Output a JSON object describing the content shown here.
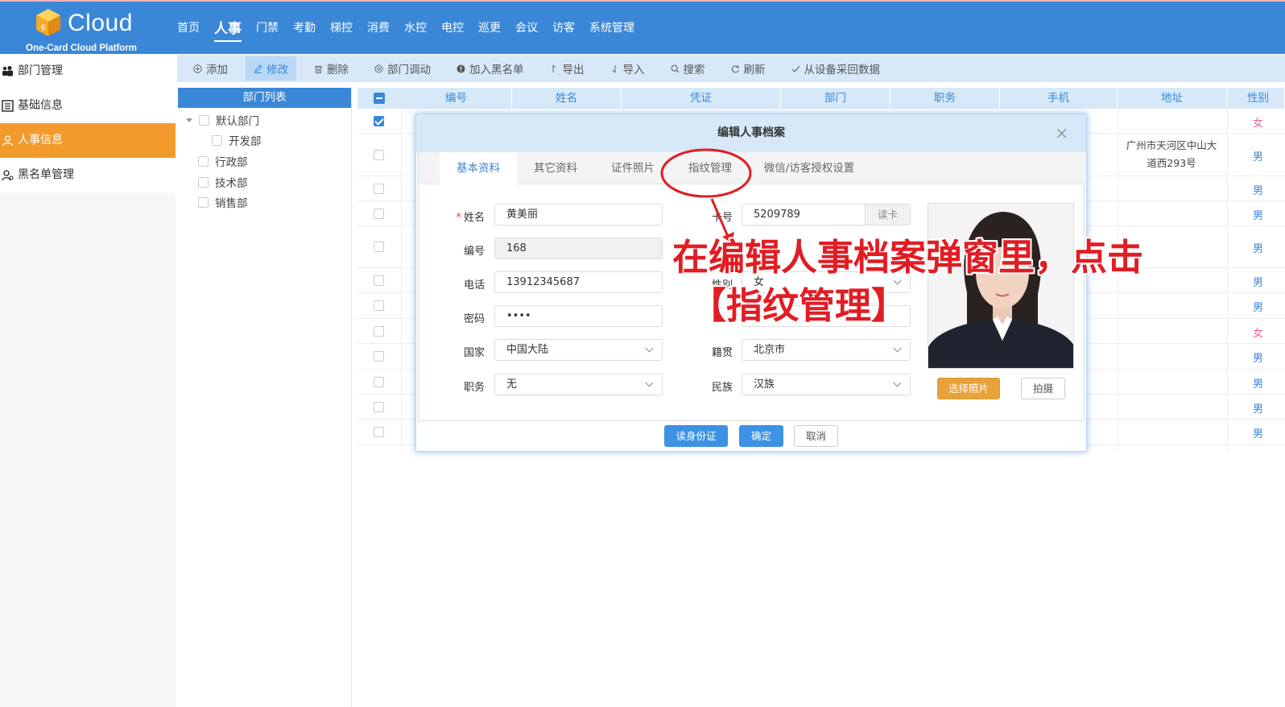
{
  "header": {
    "brand": "Cloud",
    "subtitle": "One-Card Cloud Platform",
    "cube_mark": "卡",
    "nav": [
      "首页",
      "人事",
      "门禁",
      "考勤",
      "梯控",
      "消费",
      "水控",
      "电控",
      "巡更",
      "会议",
      "访客",
      "系统管理"
    ],
    "active_nav": "人事"
  },
  "sidebar": {
    "items": [
      {
        "label": "部门管理",
        "icon": "group-icon"
      },
      {
        "label": "基础信息",
        "icon": "list-icon"
      },
      {
        "label": "人事信息",
        "icon": "user-icon"
      },
      {
        "label": "黑名单管理",
        "icon": "blacklist-user-icon"
      }
    ],
    "active": "人事信息"
  },
  "toolbar": {
    "buttons": [
      {
        "label": "添加",
        "icon": "plus-circle-icon"
      },
      {
        "label": "修改",
        "icon": "edit-icon"
      },
      {
        "label": "删除",
        "icon": "trash-icon"
      },
      {
        "label": "部门调动",
        "icon": "transfer-icon"
      },
      {
        "label": "加入黑名单",
        "icon": "blacklist-icon"
      },
      {
        "label": "导出",
        "icon": "export-icon"
      },
      {
        "label": "导入",
        "icon": "import-icon"
      },
      {
        "label": "搜索",
        "icon": "search-icon"
      },
      {
        "label": "刷新",
        "icon": "refresh-icon"
      },
      {
        "label": "从设备采回数据",
        "icon": "check-icon"
      }
    ],
    "active": "修改"
  },
  "dept_panel": {
    "title": "部门列表",
    "tree": [
      {
        "label": "默认部门",
        "level": 0,
        "expandable": true
      },
      {
        "label": "开发部",
        "level": 1
      },
      {
        "label": "行政部",
        "level": 0
      },
      {
        "label": "技术部",
        "level": 0
      },
      {
        "label": "销售部",
        "level": 0
      }
    ]
  },
  "grid": {
    "columns": [
      "编号",
      "姓名",
      "凭证",
      "部门",
      "职务",
      "手机",
      "地址",
      "性别"
    ],
    "rows": [
      {
        "checked": true,
        "gender": "女",
        "address": ""
      },
      {
        "checked": false,
        "gender": "男",
        "address_line1": "广州市天河区中山大",
        "address_line2": "道西293号"
      },
      {
        "checked": false,
        "gender": "男"
      },
      {
        "checked": false,
        "gender": "男"
      },
      {
        "checked": false,
        "gender": "男"
      },
      {
        "checked": false,
        "gender": "男"
      },
      {
        "checked": false,
        "gender": "男"
      },
      {
        "checked": false,
        "gender": "女"
      },
      {
        "checked": false,
        "gender": "男"
      },
      {
        "checked": false,
        "gender": "男"
      },
      {
        "checked": false,
        "gender": "男"
      },
      {
        "checked": false,
        "gender": "男"
      }
    ]
  },
  "modal": {
    "title": "编辑人事档案",
    "close": "×",
    "tabs": [
      "基本资料",
      "其它资料",
      "证件照片",
      "指纹管理",
      "微信/访客授权设置"
    ],
    "active_tab": "基本资料",
    "fields": {
      "name": {
        "label": "姓名",
        "value": "黄美丽",
        "required": "*"
      },
      "number": {
        "label": "编号",
        "value": "168"
      },
      "phone": {
        "label": "电话",
        "value": "13912345687"
      },
      "password": {
        "label": "密码",
        "value": "••••"
      },
      "country": {
        "label": "国家",
        "value": "中国大陆"
      },
      "position": {
        "label": "职务",
        "value": "无"
      },
      "card_no": {
        "label": "卡号",
        "value": "5209789",
        "read_card": "读卡"
      },
      "gender": {
        "label": "性别",
        "value": "女"
      },
      "native_place": {
        "label": "籍贯",
        "value": "北京市"
      },
      "ethnicity": {
        "label": "民族",
        "value": "汉族"
      }
    },
    "photo_buttons": {
      "select": "选择照片",
      "capture": "拍摄"
    },
    "footer": {
      "read_id": "读身份证",
      "ok": "确定",
      "cancel": "取消"
    }
  },
  "annotation": {
    "line1": "在编辑人事档案弹窗里，点击",
    "line2": "【指纹管理】",
    "color": "#e11d24"
  }
}
